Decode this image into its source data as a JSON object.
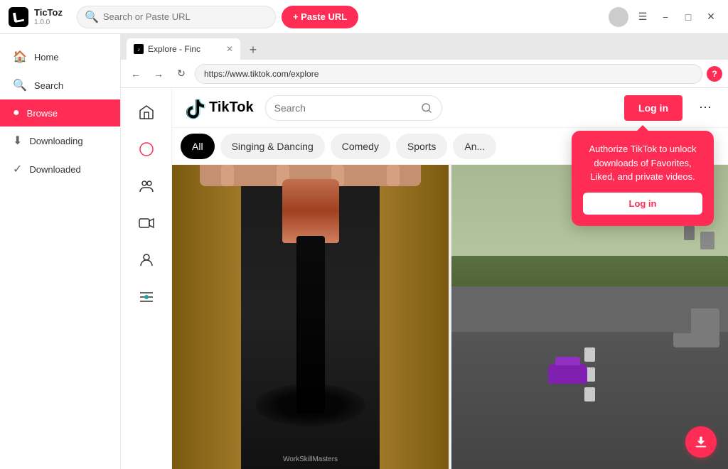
{
  "app": {
    "name": "TicToz",
    "version": "1.0.0",
    "logo_bg": "#000"
  },
  "titlebar": {
    "search_placeholder": "Search or Paste URL",
    "paste_btn": "+ Paste URL",
    "avatar_alt": "user avatar"
  },
  "window_controls": {
    "menu": "☰",
    "minimize": "−",
    "maximize": "□",
    "close": "✕"
  },
  "sidebar": {
    "items": [
      {
        "id": "home",
        "label": "Home",
        "icon": "🏠",
        "active": false
      },
      {
        "id": "search",
        "label": "Search",
        "icon": "🔍",
        "active": false
      },
      {
        "id": "browse",
        "label": "Browse",
        "icon": "●",
        "active": true
      },
      {
        "id": "downloading",
        "label": "Downloading",
        "icon": "⬇",
        "active": false
      },
      {
        "id": "downloaded",
        "label": "Downloaded",
        "icon": "✓",
        "active": false
      }
    ]
  },
  "browser": {
    "tab_label": "Explore - Finc",
    "url": "https://www.tiktok.com/explore",
    "help_icon": "?"
  },
  "tiktok": {
    "logo_text": "TikTok",
    "search_placeholder": "Search",
    "login_btn": "Log in",
    "categories": [
      {
        "id": "all",
        "label": "All",
        "active": true
      },
      {
        "id": "singing",
        "label": "Singing & Dancing",
        "active": false
      },
      {
        "id": "comedy",
        "label": "Comedy",
        "active": false
      },
      {
        "id": "sports",
        "label": "Sports",
        "active": false
      },
      {
        "id": "anime",
        "label": "An...",
        "active": false
      }
    ],
    "nav_icons": [
      {
        "id": "home",
        "icon": "⌂",
        "active": false
      },
      {
        "id": "explore",
        "icon": "🧭",
        "active": true
      },
      {
        "id": "following",
        "icon": "👥",
        "active": false
      },
      {
        "id": "live",
        "icon": "📹",
        "active": false
      },
      {
        "id": "profile",
        "icon": "👤",
        "active": false
      },
      {
        "id": "special",
        "icon": "🎪",
        "active": false
      }
    ]
  },
  "popup": {
    "text": "Authorize TikTok to unlock downloads of Favorites, Liked, and private videos.",
    "login_btn": "Log in"
  },
  "videos": [
    {
      "id": "video1",
      "watermark": "WorkSkillMasters"
    },
    {
      "id": "video2",
      "watermark": ""
    }
  ],
  "icons": {
    "search": "🔍",
    "paste_plus": "+",
    "back": "←",
    "forward": "→",
    "refresh": "↻",
    "more_dots": "⋯",
    "download": "⬇",
    "tab_close": "✕",
    "new_tab": "+",
    "tiktok_logo_symbol": "♪"
  }
}
